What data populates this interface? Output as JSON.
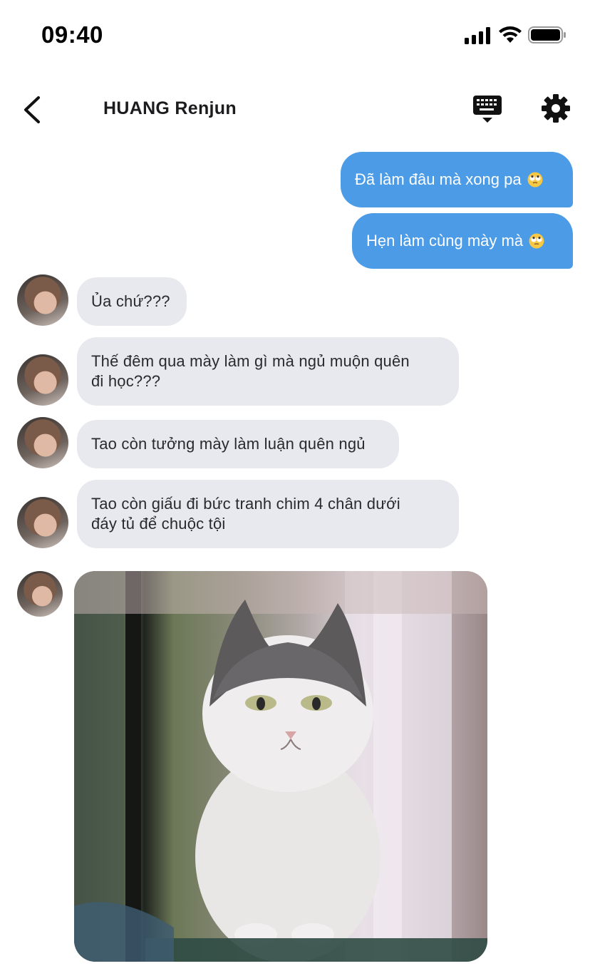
{
  "status_bar": {
    "time": "09:40"
  },
  "header": {
    "title": "HUANG Renjun"
  },
  "icons": {
    "back": "chevron-left-icon",
    "keyboard": "keyboard-icon",
    "settings": "gear-icon",
    "emoji": "eye-roll-emoji"
  },
  "colors": {
    "outgoing_bubble": "#4b9be6",
    "incoming_bubble": "#e7e9ee"
  },
  "messages": [
    {
      "direction": "out",
      "text": "Đã làm đâu mà xong pa",
      "emoji": "🙄"
    },
    {
      "direction": "out",
      "text": "Hẹn làm cùng mày mà",
      "emoji": "🙄"
    },
    {
      "direction": "in",
      "text": "Ủa chứ???"
    },
    {
      "direction": "in",
      "lines": [
        "Thế đêm qua mày làm gì mà ngủ muộn quên",
        "đi học???"
      ]
    },
    {
      "direction": "in",
      "text": "Tao còn tưởng mày làm luận quên ngủ"
    },
    {
      "direction": "in",
      "lines": [
        "Tao còn giấu đi bức tranh chim 4 chân dưới",
        "đáy tủ để chuộc tội"
      ]
    },
    {
      "direction": "in",
      "type": "image",
      "image": "cat-photo"
    }
  ]
}
